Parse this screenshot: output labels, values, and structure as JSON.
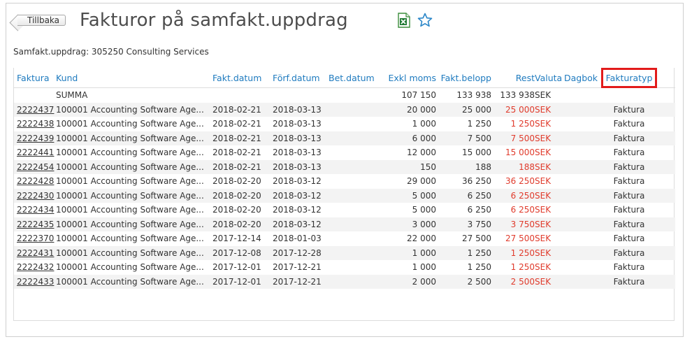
{
  "header": {
    "back_label": "Tillbaka",
    "title": "Fakturor på samfakt.uppdrag",
    "icons": {
      "excel": "excel-export-icon",
      "star": "favorite-star-icon"
    },
    "accent_color": "#1f7bbf"
  },
  "subtitle": "Samfakt.uppdrag: 305250 Consulting Services",
  "columns": {
    "faktura": "Faktura",
    "kund": "Kund",
    "fakt_datum": "Fakt.datum",
    "forf_datum": "Förf.datum",
    "bet_datum": "Bet.datum",
    "exkl_moms": "Exkl moms",
    "fakt_belopp": "Fakt.belopp",
    "rest": "Rest",
    "valuta": "Valuta",
    "dagbok": "Dagbok",
    "fakturatyp": "Fakturatyp"
  },
  "highlighted_column": "Fakturatyp",
  "highlight_color": "#e21b1b",
  "rest_color": "#e03b2c",
  "summa": {
    "label": "SUMMA",
    "exkl_moms": "107 150",
    "fakt_belopp": "133 938",
    "rest": "133 938",
    "valuta": "SEK"
  },
  "rows": [
    {
      "faktura": "2222437",
      "kund": "100001 Accounting Software Age...",
      "fakt_datum": "2018-02-21",
      "forf_datum": "2018-03-13",
      "bet_datum": "",
      "exkl_moms": "20 000",
      "fakt_belopp": "25 000",
      "rest": "25 000",
      "valuta": "SEK",
      "dagbok": "",
      "fakturatyp": "Faktura"
    },
    {
      "faktura": "2222438",
      "kund": "100001 Accounting Software Age...",
      "fakt_datum": "2018-02-21",
      "forf_datum": "2018-03-13",
      "bet_datum": "",
      "exkl_moms": "1 000",
      "fakt_belopp": "1 250",
      "rest": "1 250",
      "valuta": "SEK",
      "dagbok": "",
      "fakturatyp": "Faktura"
    },
    {
      "faktura": "2222439",
      "kund": "100001 Accounting Software Age...",
      "fakt_datum": "2018-02-21",
      "forf_datum": "2018-03-13",
      "bet_datum": "",
      "exkl_moms": "6 000",
      "fakt_belopp": "7 500",
      "rest": "7 500",
      "valuta": "SEK",
      "dagbok": "",
      "fakturatyp": "Faktura"
    },
    {
      "faktura": "2222441",
      "kund": "100001 Accounting Software Age...",
      "fakt_datum": "2018-02-21",
      "forf_datum": "2018-03-13",
      "bet_datum": "",
      "exkl_moms": "12 000",
      "fakt_belopp": "15 000",
      "rest": "15 000",
      "valuta": "SEK",
      "dagbok": "",
      "fakturatyp": "Faktura"
    },
    {
      "faktura": "2222454",
      "kund": "100001 Accounting Software Age...",
      "fakt_datum": "2018-02-21",
      "forf_datum": "2018-03-13",
      "bet_datum": "",
      "exkl_moms": "150",
      "fakt_belopp": "188",
      "rest": "188",
      "valuta": "SEK",
      "dagbok": "",
      "fakturatyp": "Faktura"
    },
    {
      "faktura": "2222428",
      "kund": "100001 Accounting Software Age...",
      "fakt_datum": "2018-02-20",
      "forf_datum": "2018-03-12",
      "bet_datum": "",
      "exkl_moms": "29 000",
      "fakt_belopp": "36 250",
      "rest": "36 250",
      "valuta": "SEK",
      "dagbok": "",
      "fakturatyp": "Faktura"
    },
    {
      "faktura": "2222430",
      "kund": "100001 Accounting Software Age...",
      "fakt_datum": "2018-02-20",
      "forf_datum": "2018-03-12",
      "bet_datum": "",
      "exkl_moms": "5 000",
      "fakt_belopp": "6 250",
      "rest": "6 250",
      "valuta": "SEK",
      "dagbok": "",
      "fakturatyp": "Faktura"
    },
    {
      "faktura": "2222434",
      "kund": "100001 Accounting Software Age...",
      "fakt_datum": "2018-02-20",
      "forf_datum": "2018-03-12",
      "bet_datum": "",
      "exkl_moms": "5 000",
      "fakt_belopp": "6 250",
      "rest": "6 250",
      "valuta": "SEK",
      "dagbok": "",
      "fakturatyp": "Faktura"
    },
    {
      "faktura": "2222435",
      "kund": "100001 Accounting Software Age...",
      "fakt_datum": "2018-02-20",
      "forf_datum": "2018-03-12",
      "bet_datum": "",
      "exkl_moms": "3 000",
      "fakt_belopp": "3 750",
      "rest": "3 750",
      "valuta": "SEK",
      "dagbok": "",
      "fakturatyp": "Faktura"
    },
    {
      "faktura": "2222370",
      "kund": "100001 Accounting Software Age...",
      "fakt_datum": "2017-12-14",
      "forf_datum": "2018-01-03",
      "bet_datum": "",
      "exkl_moms": "22 000",
      "fakt_belopp": "27 500",
      "rest": "27 500",
      "valuta": "SEK",
      "dagbok": "",
      "fakturatyp": "Faktura"
    },
    {
      "faktura": "2222431",
      "kund": "100001 Accounting Software Age...",
      "fakt_datum": "2017-12-08",
      "forf_datum": "2017-12-28",
      "bet_datum": "",
      "exkl_moms": "1 000",
      "fakt_belopp": "1 250",
      "rest": "1 250",
      "valuta": "SEK",
      "dagbok": "",
      "fakturatyp": "Faktura"
    },
    {
      "faktura": "2222432",
      "kund": "100001 Accounting Software Age...",
      "fakt_datum": "2017-12-01",
      "forf_datum": "2017-12-21",
      "bet_datum": "",
      "exkl_moms": "1 000",
      "fakt_belopp": "1 250",
      "rest": "1 250",
      "valuta": "SEK",
      "dagbok": "",
      "fakturatyp": "Faktura"
    },
    {
      "faktura": "2222433",
      "kund": "100001 Accounting Software Age...",
      "fakt_datum": "2017-12-01",
      "forf_datum": "2017-12-21",
      "bet_datum": "",
      "exkl_moms": "2 000",
      "fakt_belopp": "2 500",
      "rest": "2 500",
      "valuta": "SEK",
      "dagbok": "",
      "fakturatyp": "Faktura"
    }
  ]
}
